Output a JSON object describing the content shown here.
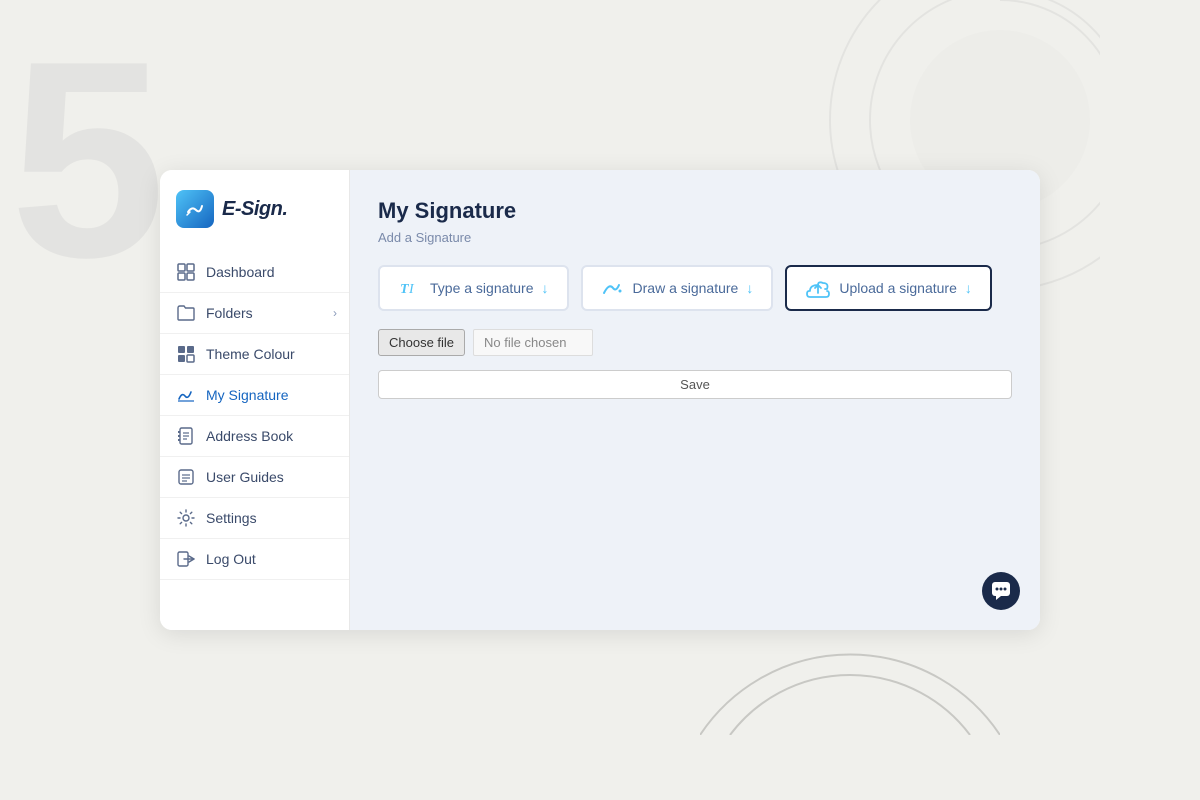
{
  "background": {
    "number": "5"
  },
  "logo": {
    "text": "E-Sign.",
    "icon_char": "✍"
  },
  "sidebar": {
    "items": [
      {
        "id": "dashboard",
        "label": "Dashboard",
        "icon": "grid",
        "active": false,
        "has_chevron": false
      },
      {
        "id": "folders",
        "label": "Folders",
        "icon": "folder",
        "active": false,
        "has_chevron": true
      },
      {
        "id": "theme-colour",
        "label": "Theme Colour",
        "icon": "theme",
        "active": false,
        "has_chevron": false
      },
      {
        "id": "my-signature",
        "label": "My Signature",
        "icon": "signature",
        "active": true,
        "has_chevron": false
      },
      {
        "id": "address-book",
        "label": "Address Book",
        "icon": "book",
        "active": false,
        "has_chevron": false
      },
      {
        "id": "user-guides",
        "label": "User Guides",
        "icon": "guide",
        "active": false,
        "has_chevron": false
      },
      {
        "id": "settings",
        "label": "Settings",
        "icon": "settings",
        "active": false,
        "has_chevron": false
      },
      {
        "id": "log-out",
        "label": "Log Out",
        "icon": "logout",
        "active": false,
        "has_chevron": false
      }
    ]
  },
  "main": {
    "title": "My Signature",
    "subtitle": "Add a Signature",
    "tabs": [
      {
        "id": "type",
        "label": "Type a signature",
        "active": false
      },
      {
        "id": "draw",
        "label": "Draw a signature",
        "active": false
      },
      {
        "id": "upload",
        "label": "Upload a signature",
        "active": true
      }
    ],
    "file_input": {
      "button_label": "Choose file",
      "placeholder": "No file chosen"
    },
    "save_button": "Save"
  },
  "chat": {
    "icon": "💬"
  }
}
